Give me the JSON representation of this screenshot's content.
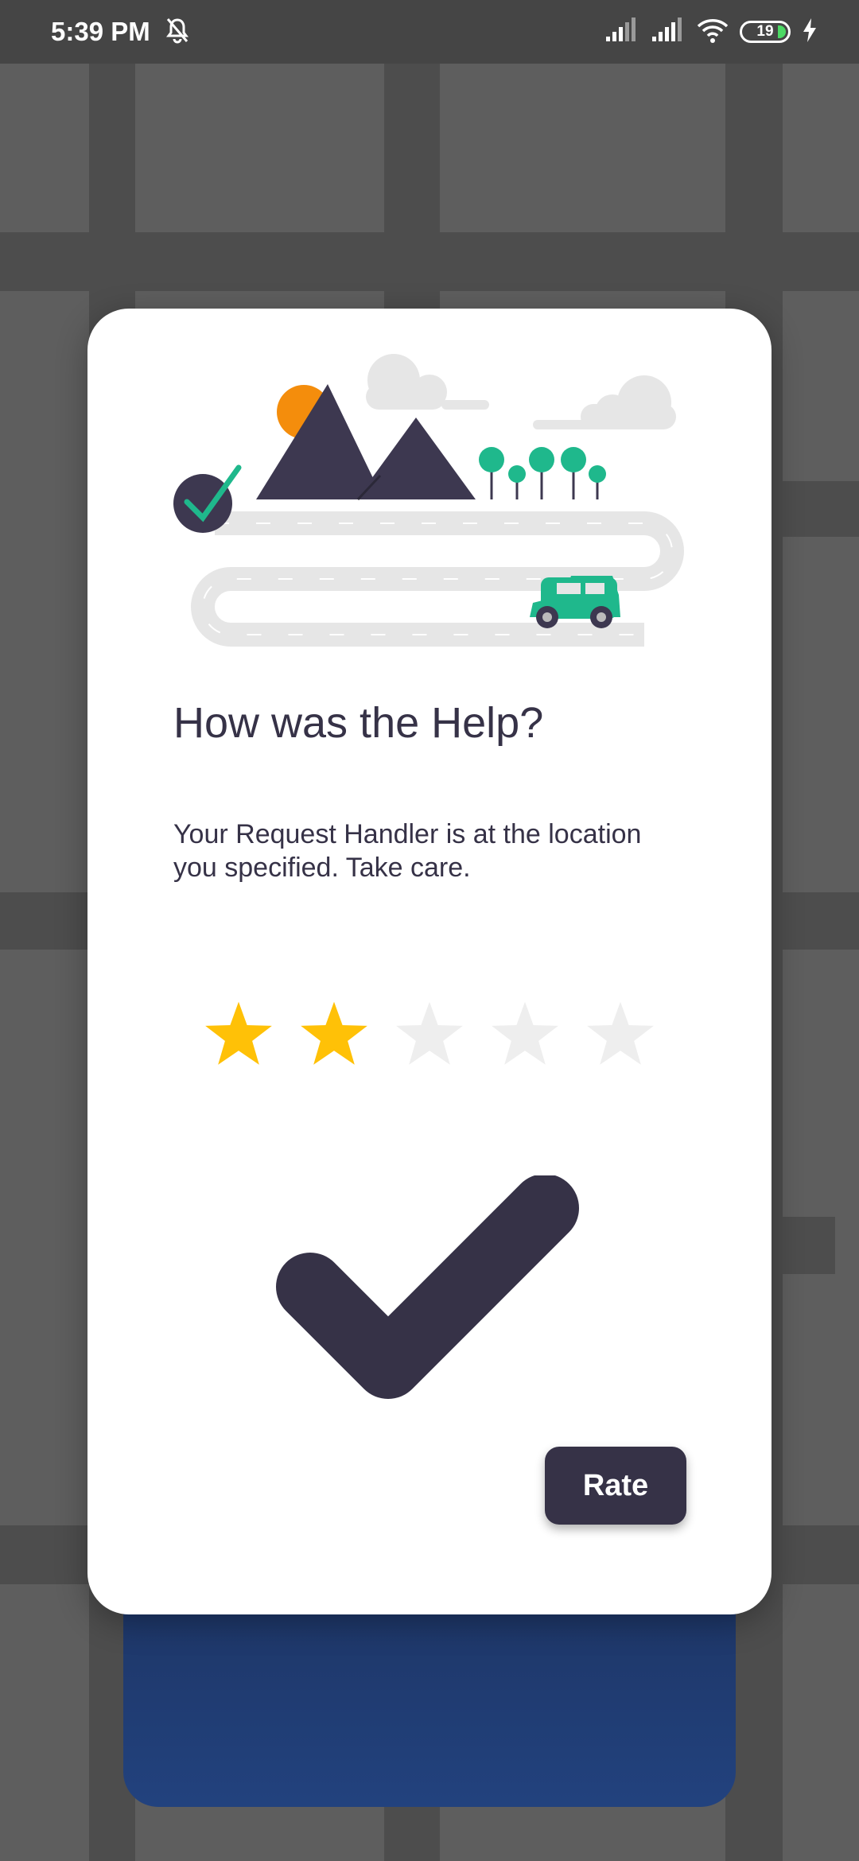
{
  "status_bar": {
    "time": "5:39 PM",
    "battery_level": "19",
    "icons": [
      "mute-icon",
      "signal-icon",
      "signal-icon",
      "wifi-icon",
      "battery-icon",
      "charging-icon"
    ]
  },
  "dialog": {
    "title": "How was the Help?",
    "message": "Your Request Handler is at the location you specified. Take care.",
    "rating": {
      "value": 2,
      "max": 5
    },
    "rate_label": "Rate"
  },
  "colors": {
    "primary": "#363247",
    "star_active": "#ffc107",
    "star_inactive": "#eeeeee",
    "accent_green": "#1fb88c",
    "sun_orange": "#f48d0c",
    "back_card_blue": "#22427e"
  }
}
